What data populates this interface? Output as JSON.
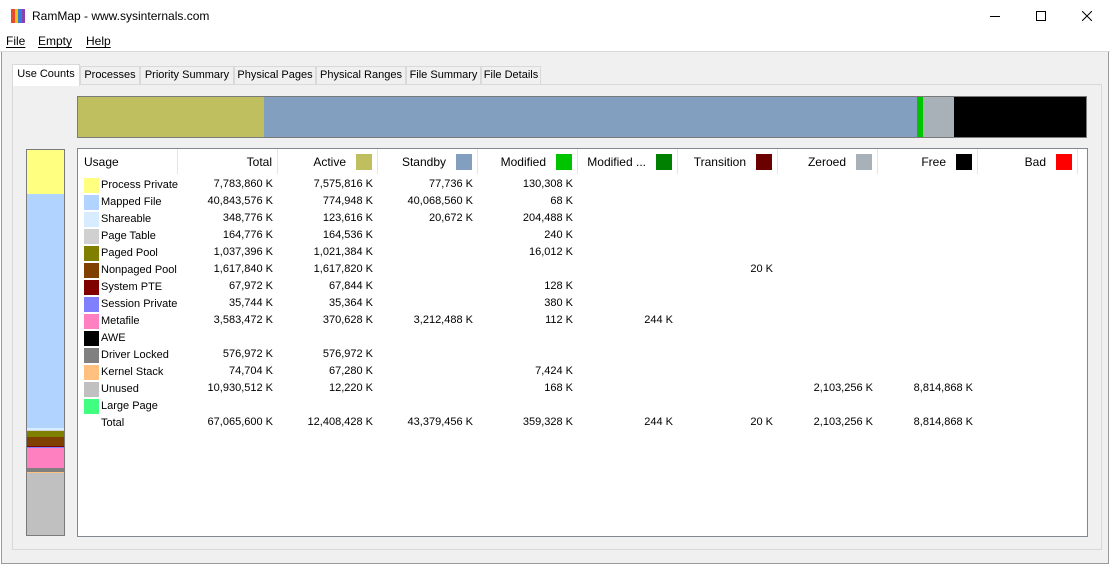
{
  "window": {
    "title": "RamMap - www.sysinternals.com"
  },
  "menu": [
    "File",
    "Empty",
    "Help"
  ],
  "tabs": [
    "Use Counts",
    "Processes",
    "Priority Summary",
    "Physical Pages",
    "Physical Ranges",
    "File Summary",
    "File Details"
  ],
  "active_tab": "Use Counts",
  "columns": [
    {
      "label": "Usage"
    },
    {
      "label": "Total"
    },
    {
      "label": "Active",
      "color": "#bfbf60"
    },
    {
      "label": "Standby",
      "color": "#829fc0"
    },
    {
      "label": "Modified",
      "color": "#00c400"
    },
    {
      "label": "Modified ...",
      "color": "#008000"
    },
    {
      "label": "Transition",
      "color": "#6a0000"
    },
    {
      "label": "Zeroed",
      "color": "#a8b0b8"
    },
    {
      "label": "Free",
      "color": "#000000"
    },
    {
      "label": "Bad",
      "color": "#ff0000"
    }
  ],
  "rows": [
    {
      "label": "Process Private",
      "color": "#ffff80",
      "values": [
        "7,783,860 K",
        "7,575,816 K",
        "77,736 K",
        "130,308 K",
        "",
        "",
        "",
        "",
        ""
      ]
    },
    {
      "label": "Mapped File",
      "color": "#b0d4ff",
      "values": [
        "40,843,576 K",
        "774,948 K",
        "40,068,560 K",
        "68 K",
        "",
        "",
        "",
        "",
        ""
      ]
    },
    {
      "label": "Shareable",
      "color": "#d8ecff",
      "values": [
        "348,776 K",
        "123,616 K",
        "20,672 K",
        "204,488 K",
        "",
        "",
        "",
        "",
        ""
      ]
    },
    {
      "label": "Page Table",
      "color": "#d0d0d0",
      "values": [
        "164,776 K",
        "164,536 K",
        "",
        "240 K",
        "",
        "",
        "",
        "",
        ""
      ]
    },
    {
      "label": "Paged Pool",
      "color": "#808000",
      "values": [
        "1,037,396 K",
        "1,021,384 K",
        "",
        "16,012 K",
        "",
        "",
        "",
        "",
        ""
      ]
    },
    {
      "label": "Nonpaged Pool",
      "color": "#804000",
      "values": [
        "1,617,840 K",
        "1,617,820 K",
        "",
        "",
        "",
        "20 K",
        "",
        "",
        ""
      ]
    },
    {
      "label": "System PTE",
      "color": "#800000",
      "values": [
        "67,972 K",
        "67,844 K",
        "",
        "128 K",
        "",
        "",
        "",
        "",
        ""
      ]
    },
    {
      "label": "Session Private",
      "color": "#8080ff",
      "values": [
        "35,744 K",
        "35,364 K",
        "",
        "380 K",
        "",
        "",
        "",
        "",
        ""
      ]
    },
    {
      "label": "Metafile",
      "color": "#ff80c0",
      "values": [
        "3,583,472 K",
        "370,628 K",
        "3,212,488 K",
        "112 K",
        "244 K",
        "",
        "",
        "",
        ""
      ]
    },
    {
      "label": "AWE",
      "color": "#000000",
      "values": [
        "",
        "",
        "",
        "",
        "",
        "",
        "",
        "",
        ""
      ]
    },
    {
      "label": "Driver Locked",
      "color": "#808080",
      "values": [
        "576,972 K",
        "576,972 K",
        "",
        "",
        "",
        "",
        "",
        "",
        ""
      ]
    },
    {
      "label": "Kernel Stack",
      "color": "#ffc080",
      "values": [
        "74,704 K",
        "67,280 K",
        "",
        "7,424 K",
        "",
        "",
        "",
        "",
        ""
      ]
    },
    {
      "label": "Unused",
      "color": "#c0c0c0",
      "values": [
        "10,930,512 K",
        "12,220 K",
        "",
        "168 K",
        "",
        "",
        "2,103,256 K",
        "8,814,868 K",
        ""
      ]
    },
    {
      "label": "Large Page",
      "color": "#40ff80",
      "values": [
        "",
        "",
        "",
        "",
        "",
        "",
        "",
        "",
        ""
      ]
    },
    {
      "label": "Total",
      "color": "",
      "values": [
        "67,065,600 K",
        "12,408,428 K",
        "43,379,456 K",
        "359,328 K",
        "244 K",
        "20 K",
        "2,103,256 K",
        "8,814,868 K",
        ""
      ]
    }
  ],
  "top_bar": [
    {
      "name": "active",
      "color": "#bfbf60",
      "fraction": 0.185
    },
    {
      "name": "standby",
      "color": "#829fc0",
      "fraction": 0.647
    },
    {
      "name": "modified",
      "color": "#00c400",
      "fraction": 0.006
    },
    {
      "name": "modified-nowrite",
      "color": "#008000",
      "fraction": 0.0
    },
    {
      "name": "transition",
      "color": "#6a0000",
      "fraction": 0.0
    },
    {
      "name": "zeroed",
      "color": "#a8b0b8",
      "fraction": 0.031
    },
    {
      "name": "free",
      "color": "#000000",
      "fraction": 0.131
    }
  ],
  "side_bar": [
    {
      "name": "process-private",
      "color": "#ffff80",
      "fraction": 0.116
    },
    {
      "name": "mapped-file",
      "color": "#b0d4ff",
      "fraction": 0.609
    },
    {
      "name": "shareable",
      "color": "#d8ecff",
      "fraction": 0.005
    },
    {
      "name": "page-table",
      "color": "#d0d0d0",
      "fraction": 0.003
    },
    {
      "name": "paged-pool",
      "color": "#808000",
      "fraction": 0.016
    },
    {
      "name": "nonpaged-pool",
      "color": "#804000",
      "fraction": 0.024
    },
    {
      "name": "system-pte",
      "color": "#800000",
      "fraction": 0.002
    },
    {
      "name": "session-private",
      "color": "#8080ff",
      "fraction": 0.002
    },
    {
      "name": "metafile",
      "color": "#ff80c0",
      "fraction": 0.053
    },
    {
      "name": "driver-locked",
      "color": "#808080",
      "fraction": 0.009
    },
    {
      "name": "kernel-stack",
      "color": "#ffc080",
      "fraction": 0.002
    },
    {
      "name": "unused",
      "color": "#c0c0c0",
      "fraction": 0.163
    }
  ]
}
